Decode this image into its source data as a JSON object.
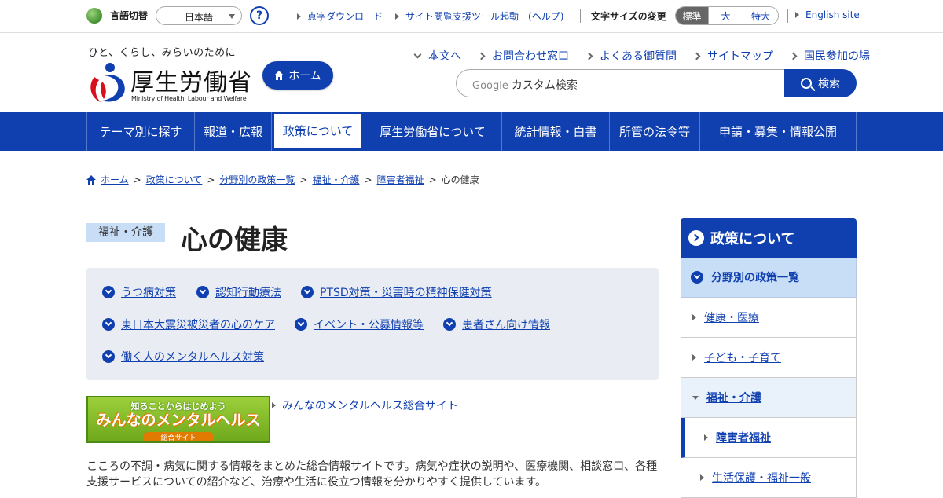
{
  "topbar": {
    "lang_label": "言語切替",
    "lang_value": "日本語",
    "help": "?",
    "links": [
      "点字ダウンロード",
      "サイト閲覧支援ツール起動　(ヘルプ)"
    ],
    "font_size_label": "文字サイズの変更",
    "font_sizes": [
      "標準",
      "大",
      "特大"
    ],
    "english": "English site"
  },
  "header": {
    "tagline": "ひと、くらし、みらいのために",
    "logo_name": "厚生労働省",
    "logo_en": "Ministry of Health, Labour and Welfare",
    "home_button": "ホーム",
    "links": [
      "本文へ",
      "お問合わせ窓口",
      "よくある御質問",
      "サイトマップ",
      "国民参加の場"
    ],
    "search_google": "Google",
    "search_placeholder": "カスタム検索",
    "search_button": "検索"
  },
  "gnav": [
    "テーマ別に探す",
    "報道・広報",
    "政策について",
    "厚生労働省について",
    "統計情報・白書",
    "所管の法令等",
    "申請・募集・情報公開"
  ],
  "breadcrumb": {
    "items": [
      "ホーム",
      "政策について",
      "分野別の政策一覧",
      "福祉・介護",
      "障害者福祉"
    ],
    "current": "心の健康"
  },
  "page": {
    "category": "福祉・介護",
    "title": "心の健康",
    "topics": [
      "うつ病対策",
      "認知行動療法",
      "PTSD対策・災害時の精神保健対策",
      "東日本大震災被災者の心のケア",
      "イベント・公募情報等",
      "患者さん向け情報",
      "働く人のメンタルヘルス対策"
    ],
    "banner": {
      "line1": "知ることからはじめよう",
      "line2": "みんなのメンタルヘルス",
      "line3": "総合サイト"
    },
    "banner_link": "みんなのメンタルヘルス総合サイト",
    "description": "こころの不調・病気に関する情報をまとめた総合情報サイトです。病気や症状の説明や、医療機関、相談窓口、各種支援サービスについての紹介など、治療や生活に役立つ情報を分かりやすく提供しています。"
  },
  "sidebar": {
    "heading": "政策について",
    "sub": "分野別の政策一覧",
    "items": [
      "健康・医療",
      "子ども・子育て",
      "福祉・介護",
      "障害者福祉",
      "生活保護・福祉一般"
    ]
  },
  "colors": {
    "primary": "#1040b0",
    "light_blue": "#c8ddf6",
    "topic_bg": "#e9edf3"
  }
}
